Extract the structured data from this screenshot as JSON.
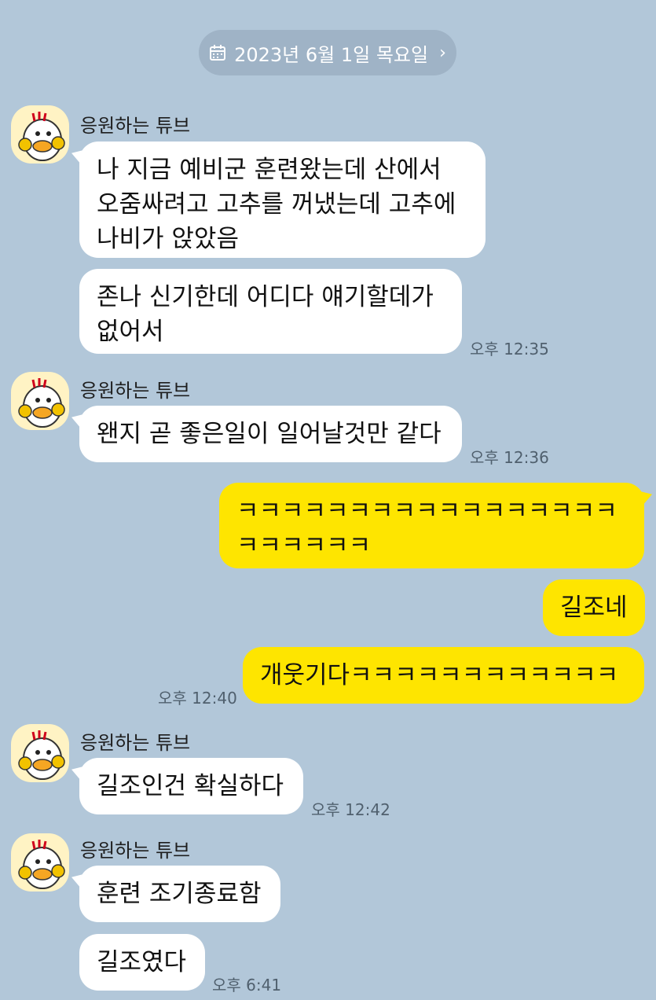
{
  "date_divider": {
    "label": "2023년 6월 1일 목요일",
    "chevron": "›",
    "icon": "calendar-icon"
  },
  "sender_name": "응원하는 튜브",
  "messages": {
    "m1": "나 지금 예비군 훈련왔는데 산에서\n오줌싸려고 고추를 꺼냈는데 고추에\n나비가 앉았음",
    "m2": "존나 신기한데 어디다 얘기할데가\n없어서",
    "m3": "왠지 곧 좋은일이 일어날것만 같다",
    "m4": "ㅋㅋㅋㅋㅋㅋㅋㅋㅋㅋㅋㅋㅋㅋㅋㅋㅋ\nㅋㅋㅋㅋㅋㅋ",
    "m5": "길조네",
    "m6": "개웃기다ㅋㅋㅋㅋㅋㅋㅋㅋㅋㅋㅋㅋ",
    "m7": "길조인건 확실하다",
    "m8": "훈련 조기종료함",
    "m9": "길조였다"
  },
  "times": {
    "t1": "오후 12:35",
    "t2": "오후 12:36",
    "t3": "오후 12:40",
    "t4": "오후 12:42",
    "t5": "오후 6:41"
  },
  "colors": {
    "background": "#b2c7d9",
    "incoming": "#ffffff",
    "outgoing": "#fee500"
  }
}
